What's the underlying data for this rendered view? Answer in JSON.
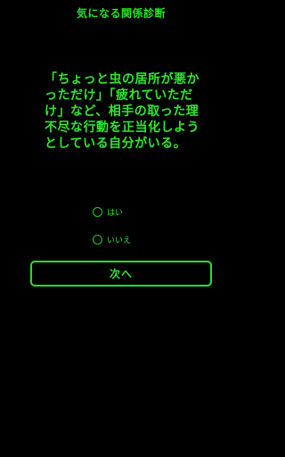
{
  "app": {
    "title": "気になる関係診断"
  },
  "question": {
    "text": "「ちょっと虫の居所が悪かっただけ」「疲れていただけ」など、相手の取った理不尽な行動を正当化しようとしている自分がいる。"
  },
  "options": [
    {
      "label": "はい",
      "selected": false
    },
    {
      "label": "いいえ",
      "selected": false
    }
  ],
  "buttons": {
    "next_label": "次へ"
  },
  "colors": {
    "background": "#000000",
    "accent": "#22e622"
  }
}
